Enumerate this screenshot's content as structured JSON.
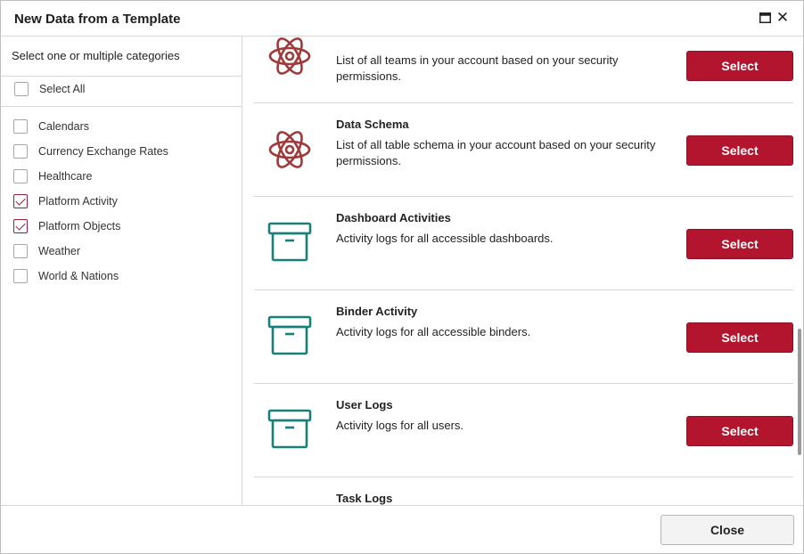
{
  "dialog": {
    "title": "New Data from a Template",
    "close_label": "Close"
  },
  "sidebar": {
    "title": "Select one or multiple categories",
    "select_all_label": "Select All",
    "categories": [
      {
        "label": "Calendars",
        "checked": false
      },
      {
        "label": "Currency Exchange Rates",
        "checked": false
      },
      {
        "label": "Healthcare",
        "checked": false
      },
      {
        "label": "Platform Activity",
        "checked": true
      },
      {
        "label": "Platform Objects",
        "checked": true
      },
      {
        "label": "Weather",
        "checked": false
      },
      {
        "label": "World & Nations",
        "checked": false
      }
    ]
  },
  "templates": [
    {
      "name": "",
      "description": "List of all teams in your account based on your security permissions.",
      "icon": "atom-icon",
      "button": "Select"
    },
    {
      "name": "Data Schema",
      "description": "List of all table schema in your account based on your security permissions.",
      "icon": "atom-icon",
      "button": "Select"
    },
    {
      "name": "Dashboard Activities",
      "description": "Activity logs for all accessible dashboards.",
      "icon": "archive-box-icon",
      "button": "Select"
    },
    {
      "name": "Binder Activity",
      "description": "Activity logs for all accessible binders.",
      "icon": "archive-box-icon",
      "button": "Select"
    },
    {
      "name": "User Logs",
      "description": "Activity logs for all users.",
      "icon": "archive-box-icon",
      "button": "Select"
    },
    {
      "name": "Task Logs",
      "description": "",
      "icon": "",
      "button": ""
    }
  ],
  "colors": {
    "accent": "#b3142e",
    "atom_icon": "#9e3a3a",
    "box_icon": "#17807a"
  }
}
